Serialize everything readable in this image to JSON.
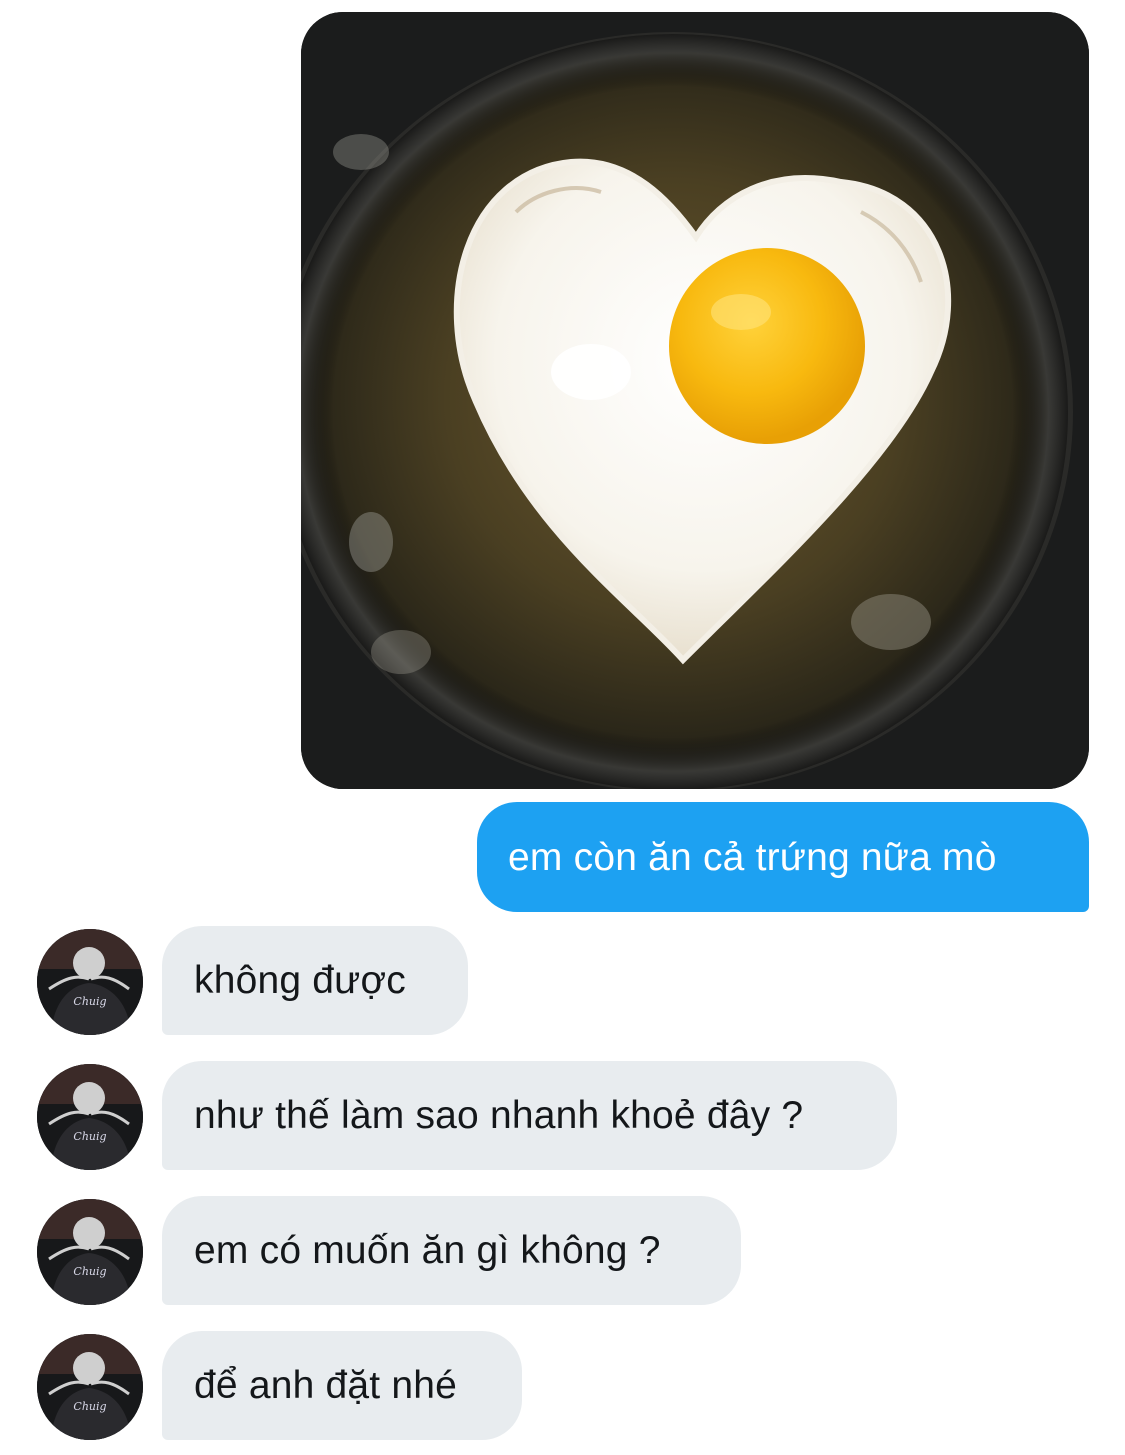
{
  "conversation": {
    "sent_photo": {
      "subject": "heart-shaped fried egg in a pan"
    },
    "sent_message": {
      "text": "em còn ăn cả trứng nữa mò",
      "color": "#1da1f2"
    },
    "received_messages": [
      {
        "text": "không được"
      },
      {
        "text": "như thế làm sao nhanh khoẻ đây ?"
      },
      {
        "text": "em có muốn ăn gì không ?"
      },
      {
        "text": "để anh đặt nhé"
      }
    ],
    "avatar": {
      "caption": "Chuig"
    },
    "colors": {
      "received_bubble": "#e8ecef",
      "received_text": "#14171a",
      "sent_text": "#ffffff"
    }
  }
}
